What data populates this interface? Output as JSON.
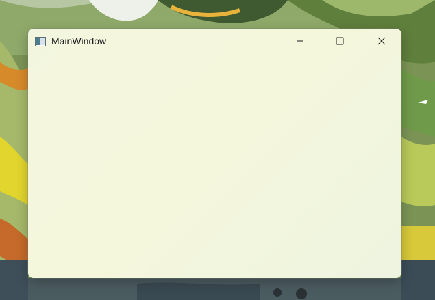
{
  "window": {
    "title": "MainWindow",
    "icon": "app-window-icon",
    "controls": {
      "minimize_icon": "minimize-icon",
      "maximize_icon": "maximize-icon",
      "close_icon": "close-icon"
    }
  },
  "colors": {
    "window_bg": "#f3f6df",
    "title_text": "#1b1b1b"
  }
}
